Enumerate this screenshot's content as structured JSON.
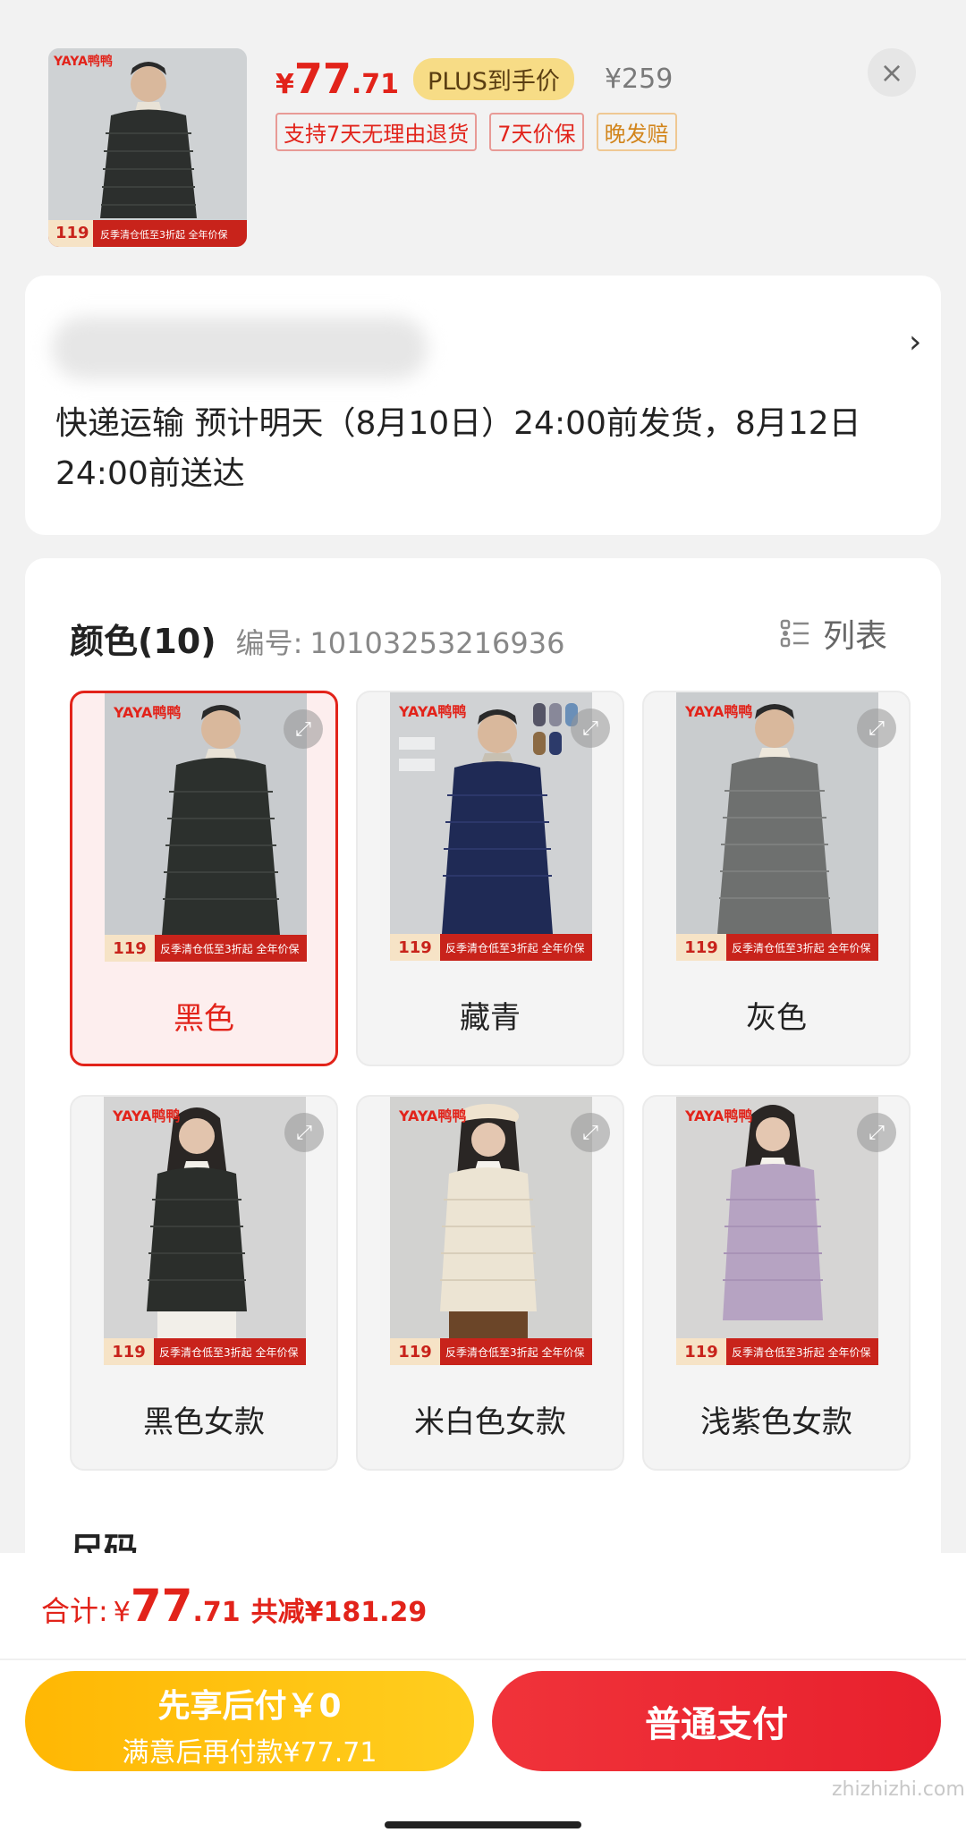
{
  "header": {
    "thumb": {
      "brand": "YAYA鸭鸭",
      "price_badge": "119",
      "promo": "反季清仓低至3折起 全年价保"
    },
    "price": {
      "yen": "¥",
      "int": "77",
      "dec": ".71"
    },
    "plus_tag": "PLUS到手价",
    "original_price": "¥259",
    "tags": [
      "支持7天无理由退货",
      "7天价保",
      "晚发赔"
    ],
    "close_icon": "×"
  },
  "address": {
    "arrow": "›",
    "delivery": "快递运输 预计明天（8月10日）24:00前发货，8月12日24:00前送达"
  },
  "sku": {
    "title": "颜色(10)",
    "code_label": "编号:",
    "code": "10103253216936",
    "list_toggle": "列表",
    "options": [
      {
        "label": "黑色",
        "brand": "YAYA鸭鸭",
        "price": "119",
        "promo": "反季清仓低至3折起 全年价保",
        "selected": true
      },
      {
        "label": "藏青",
        "brand": "YAYA鸭鸭",
        "price": "119",
        "promo": "反季清仓低至3折起 全年价保",
        "selected": false
      },
      {
        "label": "灰色",
        "brand": "YAYA鸭鸭",
        "price": "119",
        "promo": "反季清仓低至3折起 全年价保",
        "selected": false
      },
      {
        "label": "黑色女款",
        "brand": "YAYA鸭鸭",
        "price": "119",
        "promo": "反季清仓低至3折起 全年价保",
        "selected": false
      },
      {
        "label": "米白色女款",
        "brand": "YAYA鸭鸭",
        "price": "119",
        "promo": "反季清仓低至3折起 全年价保",
        "selected": false
      },
      {
        "label": "浅紫色女款",
        "brand": "YAYA鸭鸭",
        "price": "119",
        "promo": "反季清仓低至3折起 全年价保",
        "selected": false
      }
    ],
    "size_title": "尺码"
  },
  "footer": {
    "total_label": "合计:",
    "total_yen": "¥",
    "total_int": "77",
    "total_dec": ".71",
    "saved": "共减¥181.29",
    "later_main": "先享后付￥0",
    "later_sub": "满意后再付款¥77.71",
    "pay_label": "普通支付",
    "watermark": "zhizhizhi.com"
  },
  "colors": {
    "accent": "#e2231a",
    "gold": "#ffb703",
    "plus_bg": "#f7dc86"
  }
}
